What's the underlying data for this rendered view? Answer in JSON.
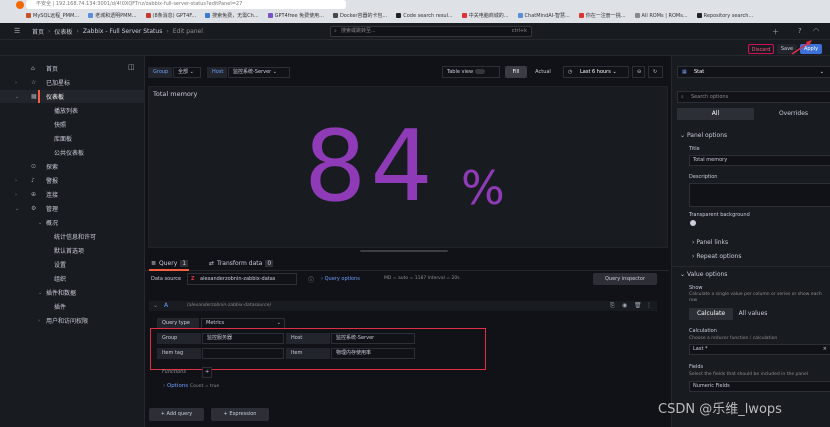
{
  "browser": {
    "address": "不安全 | 192.168.74.134:3001/d/4!0XQFTnz/zabbix-full-server-status?editPanel=27",
    "bookmarks": [
      "MySQL远程_PMM...",
      "老城和透明PMM...",
      "(8条消息) GPT4F...",
      "搜索免费，无需Ch...",
      "GPT4free 免费使用...",
      "Docker容器的卡包...",
      "Code search resul...",
      "中关电脑商城的...",
      "ChatMindAI-智慧...",
      "你在一注册一挑...",
      "All ROMs | ROMs...",
      "Repository search..."
    ]
  },
  "topbar": {
    "breadcrumbs": [
      "首页",
      "仪表板",
      "Zabbix - Full Server Status",
      "Edit panel"
    ],
    "search_placeholder": "搜索或跳转至...",
    "search_shortcut": "ctrl+k"
  },
  "subbar": {
    "discard": "Discard",
    "save": "Save",
    "apply": "Apply",
    "group_label": "Group",
    "group_value": "全部",
    "host_label": "Host",
    "host_value": "监控系统-Server",
    "table_view": "Table view",
    "fill": "Fill",
    "actual": "Actual",
    "time_range": "Last 6 hours",
    "viz_type": "Stat"
  },
  "sidebar": {
    "items": [
      {
        "label": "首页",
        "icon": "home-icon",
        "chev": ""
      },
      {
        "label": "已加星标",
        "icon": "star-icon",
        "chev": "›"
      },
      {
        "label": "仪表板",
        "icon": "apps-icon",
        "chev": "⌄",
        "active": true
      },
      {
        "label": "播放列表",
        "sub": true
      },
      {
        "label": "快照",
        "sub": true
      },
      {
        "label": "库面板",
        "sub": true
      },
      {
        "label": "公共仪表板",
        "sub": true
      },
      {
        "label": "探索",
        "icon": "compass-icon",
        "chev": ""
      },
      {
        "label": "警报",
        "icon": "bell-icon",
        "chev": "›"
      },
      {
        "label": "连接",
        "icon": "link-icon",
        "chev": "›"
      },
      {
        "label": "管理",
        "icon": "cog-icon",
        "chev": "⌄"
      },
      {
        "label": "概况",
        "sub": true,
        "chev": "⌄"
      },
      {
        "label": "统计信息和许可",
        "sub2": true
      },
      {
        "label": "默认首选项",
        "sub2": true
      },
      {
        "label": "设置",
        "sub2": true
      },
      {
        "label": "组织",
        "sub2": true
      },
      {
        "label": "插件和数据",
        "sub": true,
        "chev": "⌄"
      },
      {
        "label": "插件",
        "sub2": true
      },
      {
        "label": "用户和访问权限",
        "sub": true,
        "chev": "›"
      }
    ]
  },
  "panel": {
    "title": "Total memory",
    "value": "84",
    "unit": "%",
    "value_color": "#8f3bb8"
  },
  "query": {
    "tab_query": "Query",
    "tab_query_count": "1",
    "tab_transform": "Transform data",
    "tab_transform_count": "0",
    "datasource_label": "Data source",
    "datasource_value": "alexanderzobnin-zabbix-datas",
    "query_options": "Query options",
    "query_options_meta": "MD = auto = 1187    Interval = 20s",
    "query_inspector": "Query inspector",
    "row_letter": "A",
    "row_ds": "(alexanderzobnin-zabbix-datasource)",
    "query_type_label": "Query type",
    "query_type_value": "Metrics",
    "group_label": "Group",
    "group_value": "监控服务器",
    "host_label": "Host",
    "host_value": "监控系统-Server",
    "item_tag_label": "Item tag",
    "item_tag_value": "",
    "item_label": "Item",
    "item_value": "物理内存使用率",
    "functions_label": "Functions",
    "options_label": "Options",
    "options_meta": "Count = true",
    "add_query": "Add query",
    "expression": "Expression"
  },
  "options_pane": {
    "search_placeholder": "Search options",
    "tab_all": "All",
    "tab_overrides": "Overrides",
    "panel_options": "Panel options",
    "title_label": "Title",
    "title_value": "Total memory",
    "description_label": "Description",
    "transparent_label": "Transparent background",
    "panel_links": "Panel links",
    "repeat_options": "Repeat options",
    "value_options": "Value options",
    "show_label": "Show",
    "show_hint": "Calculate a single value per column or series or show each row",
    "calculate": "Calculate",
    "all_values": "All values",
    "calculation_label": "Calculation",
    "calculation_hint": "Choose a reducer function / calculation",
    "calculation_value": "Last *",
    "fields_label": "Fields",
    "fields_hint": "Select the fields that should be included in the panel",
    "fields_value": "Numeric Fields"
  },
  "watermark": "CSDN @乐维_lwops",
  "colors": {
    "accent": "#3d71d9",
    "discard": "#d10e5c",
    "highlight": "#e02f44",
    "panel_bg": "#181b1f"
  }
}
